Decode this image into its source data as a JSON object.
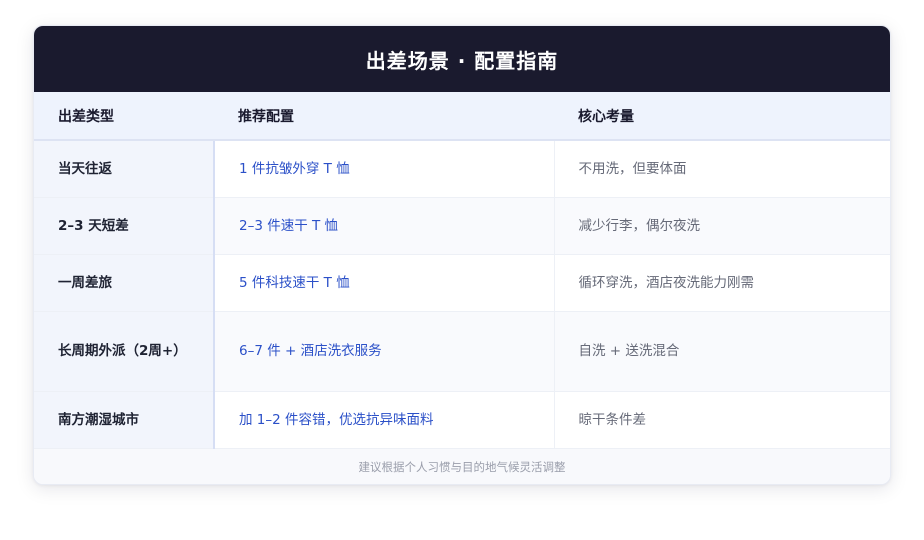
{
  "title": "出差场景 · 配置指南",
  "columns": [
    "出差类型",
    "推荐配置",
    "核心考量"
  ],
  "rows": [
    {
      "type": "当天往返",
      "recommendation": "1 件抗皱外穿 T 恤",
      "consideration": "不用洗，但要体面"
    },
    {
      "type": "2–3 天短差",
      "recommendation": "2–3 件速干 T 恤",
      "consideration": "减少行李，偶尔夜洗"
    },
    {
      "type": "一周差旅",
      "recommendation": "5 件科技速干 T 恤",
      "consideration": "循环穿洗，酒店夜洗能力刚需"
    },
    {
      "type": "长周期外派（2周+）",
      "recommendation": "6–7 件 + 酒店洗衣服务",
      "consideration": "自洗 + 送洗混合"
    },
    {
      "type": "南方潮湿城市",
      "recommendation": "加 1–2 件容错，优选抗异味面料",
      "consideration": "晾干条件差"
    }
  ],
  "footer": "建议根据个人习惯与目的地气候灵活调整",
  "colors": {
    "header_bg": "#1a1a2e",
    "accent_text": "#2b50c8",
    "muted_text": "#666a78"
  }
}
